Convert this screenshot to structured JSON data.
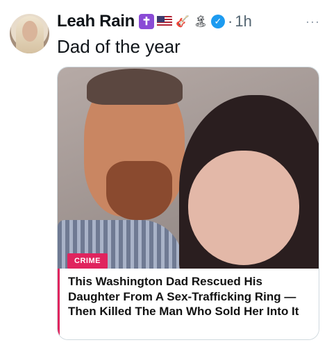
{
  "tweet": {
    "author_name": "Leah Rain",
    "emoji_icons": [
      "latin-cross-icon",
      "us-flag-icon",
      "guitar-icon",
      "palm-island-icon"
    ],
    "verified": true,
    "separator": "·",
    "time": "1h",
    "more": "···",
    "text": "Dad of the year"
  },
  "card": {
    "category": "CRIME",
    "headline": "This Washington Dad Rescued His Daughter From A Sex-Trafficking Ring — Then Killed The Man Who Sold Her Into It"
  },
  "colors": {
    "verified": "#1d9bf0",
    "badge": "#e0245e",
    "muted_text": "#536471"
  }
}
